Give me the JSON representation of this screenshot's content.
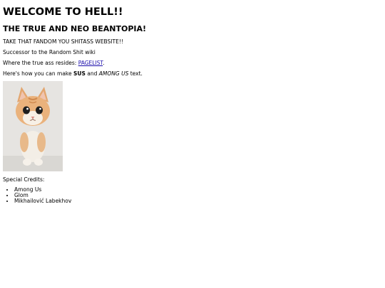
{
  "heading": "WELCOME TO HELL!!",
  "subheading": "THE TRUE AND NEO BEANTOPIA!",
  "line1": "TAKE THAT FANDOM YOU SHITASS WEBSITE!!",
  "line2": "Successor to the Random Shit wiki",
  "line3": {
    "prefix": "Where the true ass resides: ",
    "link": "PAGELIST",
    "suffix": "."
  },
  "line4": {
    "prefix": "Here's how you can make ",
    "bold": "SUS",
    "middle": " and ",
    "italic": "AMONG US",
    "suffix": " text."
  },
  "credits_label": "Special Credits:",
  "credits": [
    "Among Us",
    "Glom",
    "Mikhailović Labekhov"
  ],
  "colors": {
    "link": "#1a0dab",
    "text": "#000000",
    "background": "#ffffff"
  },
  "image": "kitten-photo"
}
